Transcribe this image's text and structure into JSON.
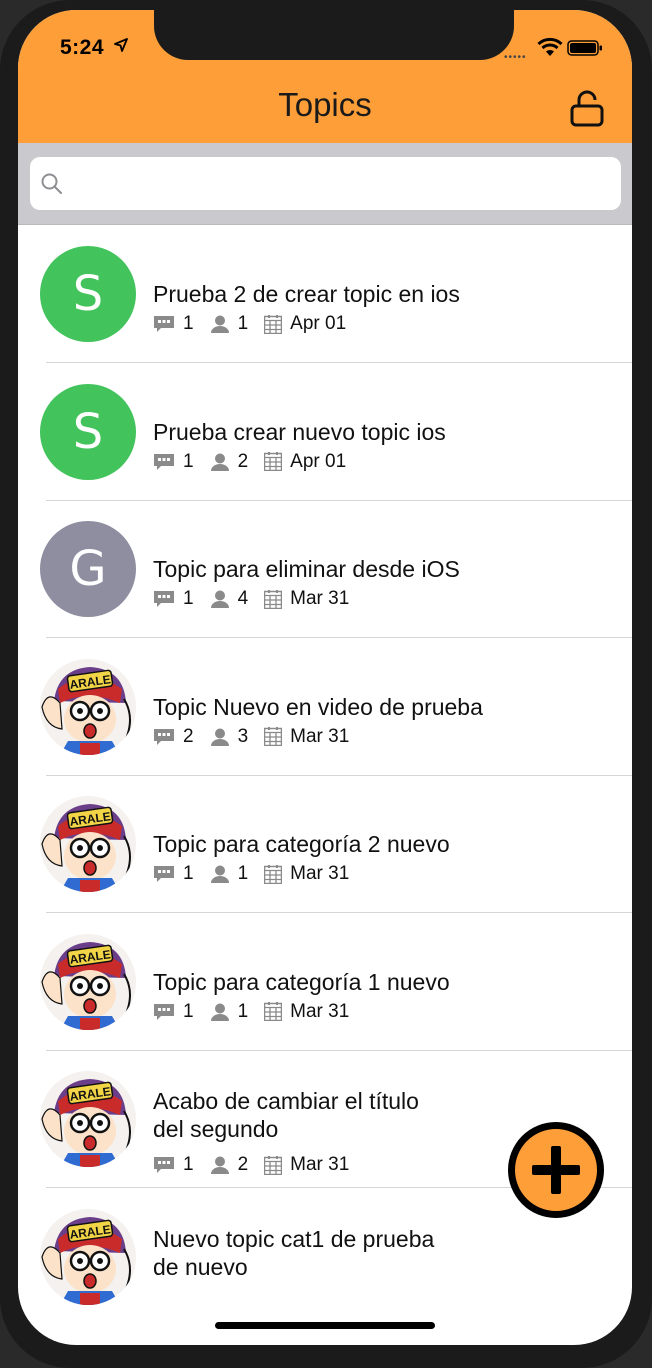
{
  "status_bar": {
    "time": "5:24",
    "dots": "•••••"
  },
  "header": {
    "title": "Topics"
  },
  "search": {
    "placeholder": "",
    "value": ""
  },
  "colors": {
    "accent": "#fd9e38",
    "green": "#43c35c",
    "gray_avatar": "#8e8ea0",
    "meta_icon": "#8a8a8a"
  },
  "topics": [
    {
      "title_line1": "Prueba 2 de crear topic en ios",
      "title_line2": "",
      "avatar_type": "letter",
      "avatar_letter": "S",
      "avatar_color": "#43c35c",
      "comments": "1",
      "users": "1",
      "date": "Apr 01"
    },
    {
      "title_line1": "Prueba crear nuevo topic ios",
      "title_line2": "",
      "avatar_type": "letter",
      "avatar_letter": "S",
      "avatar_color": "#43c35c",
      "comments": "1",
      "users": "2",
      "date": "Apr 01"
    },
    {
      "title_line1": "Topic para eliminar desde iOS",
      "title_line2": "",
      "avatar_type": "letter",
      "avatar_letter": "G",
      "avatar_color": "#8e8ea0",
      "comments": "1",
      "users": "4",
      "date": "Mar 31"
    },
    {
      "title_line1": "Topic Nuevo en video de prueba",
      "title_line2": "",
      "avatar_type": "image",
      "avatar_label": "ARALE",
      "comments": "2",
      "users": "3",
      "date": "Mar 31"
    },
    {
      "title_line1": "Topic para categoría 2 nuevo",
      "title_line2": "",
      "avatar_type": "image",
      "avatar_label": "ARALE",
      "comments": "1",
      "users": "1",
      "date": "Mar 31"
    },
    {
      "title_line1": "Topic para categoría 1 nuevo",
      "title_line2": "",
      "avatar_type": "image",
      "avatar_label": "ARALE",
      "comments": "1",
      "users": "1",
      "date": "Mar 31"
    },
    {
      "title_line1": "Acabo de cambiar el título",
      "title_line2": "del segundo",
      "avatar_type": "image",
      "avatar_label": "ARALE",
      "comments": "1",
      "users": "2",
      "date": "Mar 31"
    },
    {
      "title_line1": "Nuevo topic cat1 de prueba",
      "title_line2": "de nuevo",
      "avatar_type": "image",
      "avatar_label": "ARALE",
      "comments": "",
      "users": "",
      "date": ""
    }
  ],
  "fab": {
    "icon": "plus-icon"
  }
}
